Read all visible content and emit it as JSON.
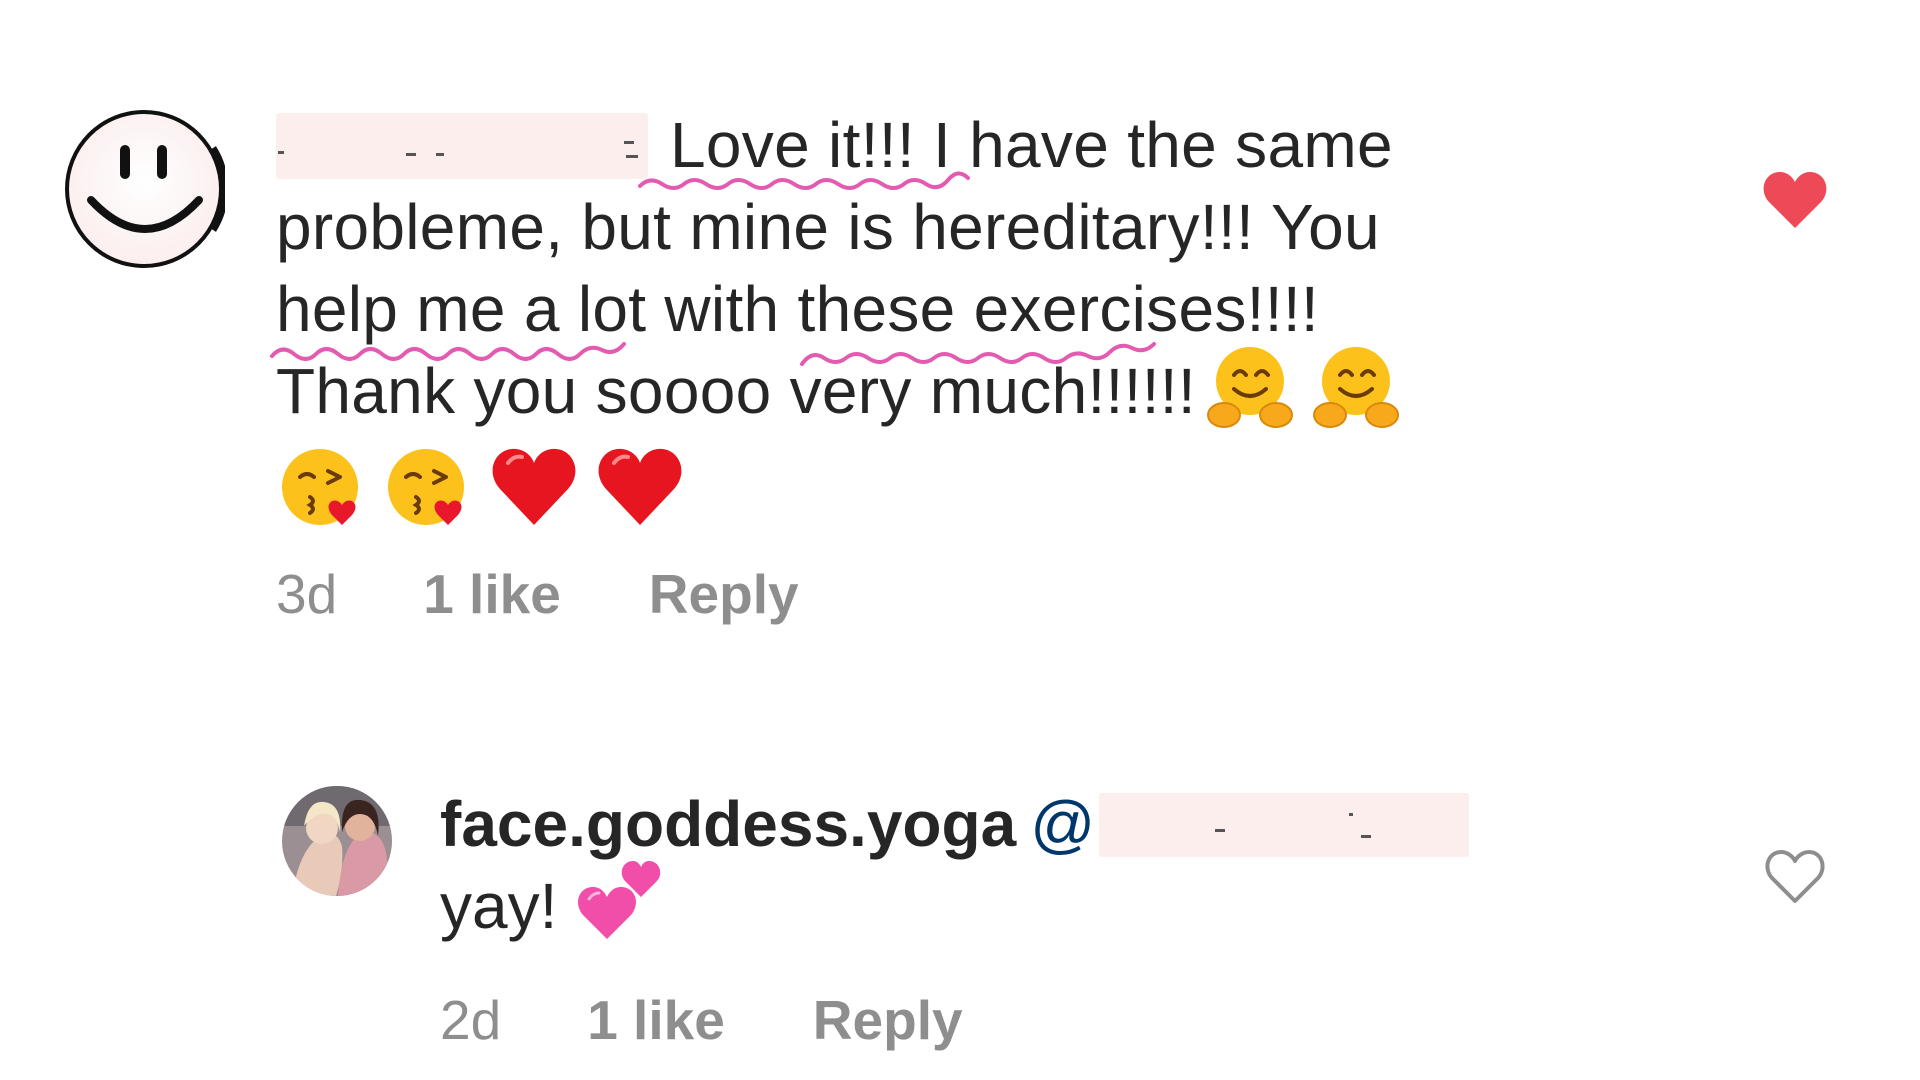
{
  "comments": [
    {
      "author": "",
      "text_line1": "Love it!!! I have the same",
      "text_line2": "probleme, but mine is hereditary!!! You",
      "text_line3": "help me a lot with these exercises!!!!",
      "text_line4": "Thank you soooo very much!!!!!!",
      "emojis_line4": [
        "hugging-face",
        "hugging-face"
      ],
      "emojis_line5": [
        "face-blowing-kiss",
        "face-blowing-kiss",
        "red-heart",
        "red-heart"
      ],
      "age": "3d",
      "likes": "1 like",
      "reply": "Reply",
      "liked": true
    },
    {
      "author": "face.goddess.yoga",
      "mention_prefix": "@",
      "text": "yay!",
      "emojis": [
        "two-hearts"
      ],
      "age": "2d",
      "likes": "1 like",
      "reply": "Reply",
      "liked": false
    }
  ],
  "colors": {
    "text": "#262626",
    "meta": "#8e8e8e",
    "mention": "#00376b",
    "heart_liked": "#ed4956",
    "spellcheck_squiggle": "#e35bb0",
    "redaction": "#fdeeee"
  }
}
